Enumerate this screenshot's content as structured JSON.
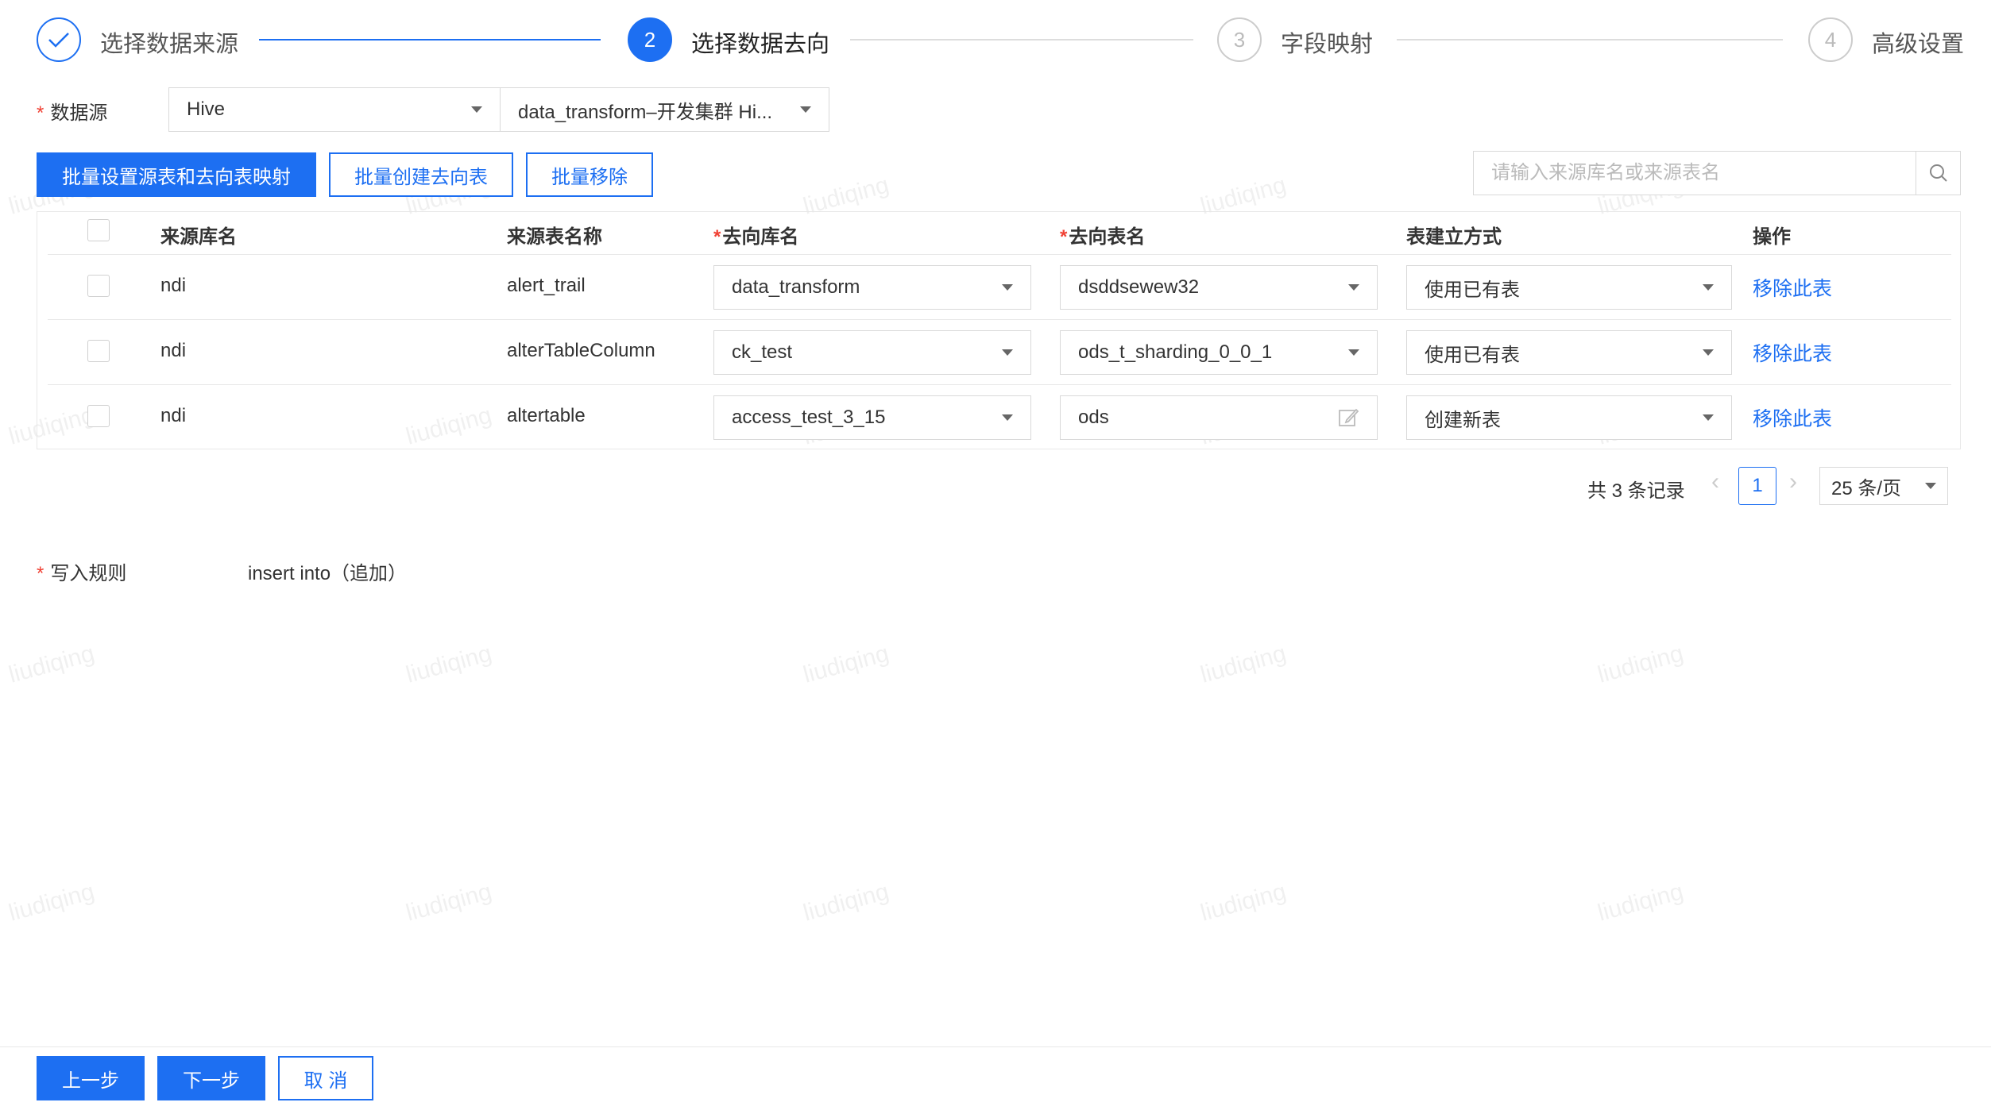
{
  "steps": [
    {
      "number": "1",
      "label": "选择数据来源",
      "state": "done"
    },
    {
      "number": "2",
      "label": "选择数据去向",
      "state": "active"
    },
    {
      "number": "3",
      "label": "字段映射",
      "state": "pending"
    },
    {
      "number": "4",
      "label": "高级设置",
      "state": "pending"
    }
  ],
  "datasource": {
    "label": "数据源",
    "type_value": "Hive",
    "cluster_value": "data_transform–开发集群 Hi..."
  },
  "toolbar": {
    "batch_mapping_label": "批量设置源表和去向表映射",
    "batch_create_label": "批量创建去向表",
    "batch_remove_label": "批量移除",
    "search_placeholder": "请输入来源库名或来源表名"
  },
  "table": {
    "columns": [
      "来源库名",
      "来源表名称",
      "去向库名",
      "去向表名",
      "表建立方式",
      "操作"
    ],
    "rows": [
      {
        "src_db": "ndi",
        "src_table": "alert_trail",
        "dst_db": "data_transform",
        "dst_table": "dsddsewew32",
        "create_mode": "使用已有表",
        "action": "移除此表",
        "dst_table_editable": false
      },
      {
        "src_db": "ndi",
        "src_table": "alterTableColumn",
        "dst_db": "ck_test",
        "dst_table": "ods_t_sharding_0_0_1",
        "create_mode": "使用已有表",
        "action": "移除此表",
        "dst_table_editable": false
      },
      {
        "src_db": "ndi",
        "src_table": "altertable",
        "dst_db": "access_test_3_15",
        "dst_table": "ods",
        "create_mode": "创建新表",
        "action": "移除此表",
        "dst_table_editable": true
      }
    ]
  },
  "pagination": {
    "total_text": "共 3 条记录",
    "current_page": "1",
    "page_size": "25 条/页"
  },
  "write_rule": {
    "label": "写入规则",
    "value": "insert into（追加）"
  },
  "footer": {
    "prev_label": "上一步",
    "next_label": "下一步",
    "cancel_label": "取 消"
  },
  "watermark": "liudiqing",
  "colors": {
    "primary": "#1d6ff2",
    "required": "#f04134",
    "border": "#d9d9d9"
  }
}
